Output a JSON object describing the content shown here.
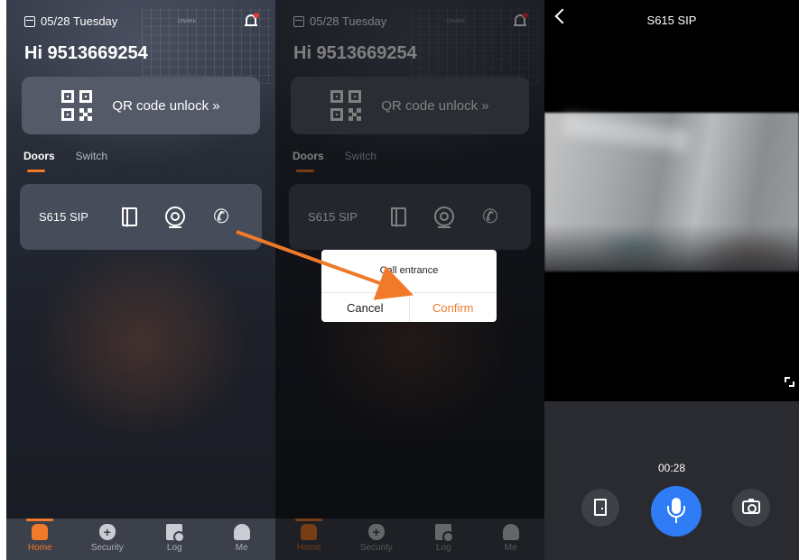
{
  "home": {
    "date": "05/28 Tuesday",
    "greeting": "Hi 9513669254",
    "qr_label": "QR code unlock »",
    "tabs": [
      "Doors",
      "Switch"
    ],
    "door_name": "S615 SIP",
    "nav": [
      {
        "label": "Home",
        "icon": "home-icon"
      },
      {
        "label": "Security",
        "icon": "shield-icon"
      },
      {
        "label": "Log",
        "icon": "log-icon"
      },
      {
        "label": "Me",
        "icon": "profile-icon"
      }
    ]
  },
  "dialog": {
    "title": "Call entrance",
    "cancel": "Cancel",
    "confirm": "Confirm"
  },
  "call": {
    "title": "S615 SIP",
    "timer": "00:28"
  },
  "colors": {
    "accent": "#f07a2a",
    "mic_button": "#2f7cf6",
    "card": "#464c59"
  }
}
